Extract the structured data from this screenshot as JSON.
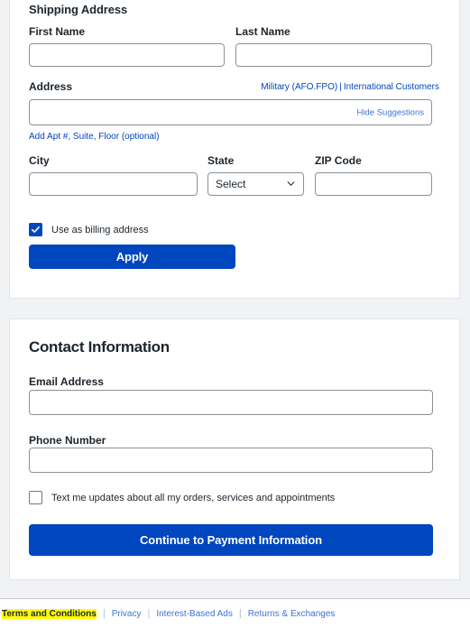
{
  "shipping": {
    "title": "Shipping Address",
    "first_name": {
      "label": "First Name",
      "value": "",
      "placeholder": ""
    },
    "last_name": {
      "label": "Last Name",
      "value": "",
      "placeholder": ""
    },
    "address": {
      "label": "Address",
      "value": "",
      "placeholder": "",
      "military_link": "Military (AFO.FPO)",
      "divider": "|",
      "international_link": "International Customers",
      "hide_suggestions_link": "Hide Suggestions",
      "add_apt_link": "Add Apt #, Suite, Floor (optional)"
    },
    "city": {
      "label": "City",
      "value": "",
      "placeholder": ""
    },
    "state": {
      "label": "State",
      "selected": "Select"
    },
    "zip": {
      "label": "ZIP Code",
      "value": "",
      "placeholder": ""
    },
    "billing_checkbox": {
      "label": "Use as billing address",
      "checked": true
    },
    "apply_button": "Apply"
  },
  "contact": {
    "title": "Contact Information",
    "email": {
      "label": "Email Address",
      "value": "",
      "placeholder": ""
    },
    "phone": {
      "label": "Phone Number",
      "value": "",
      "placeholder": ""
    },
    "text_updates_checkbox": {
      "label": "Text me updates about all my orders, services and appointments",
      "checked": false
    },
    "continue_button": "Continue to Payment Information"
  },
  "footer": {
    "links": [
      {
        "label": "Terms and Conditions",
        "highlighted": true
      },
      {
        "label": "Privacy",
        "highlighted": false
      },
      {
        "label": "Interest-Based Ads",
        "highlighted": false
      },
      {
        "label": "Returns & Exchanges",
        "highlighted": false
      }
    ]
  },
  "colors": {
    "brand_blue": "#0046be",
    "link_blue": "#3e73d4",
    "page_bg": "#f1f2f4",
    "highlight_yellow": "#ffff00",
    "input_border": "#8c9196",
    "text": "#1d252c"
  }
}
